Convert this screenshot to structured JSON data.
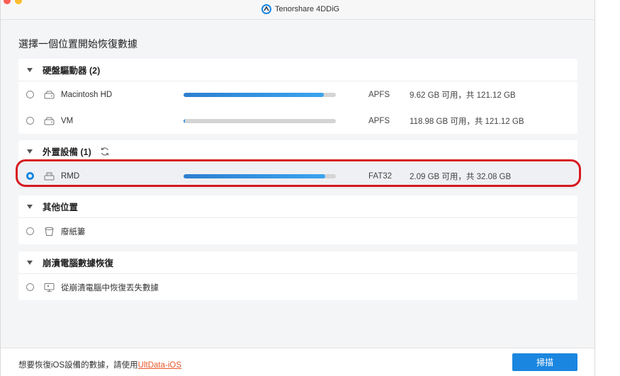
{
  "window": {
    "app_title": "Tenorshare 4DDiG"
  },
  "page": {
    "heading": "選擇一個位置開始恢復數據"
  },
  "sections": {
    "hard_drives": {
      "title": "硬盤驅動器 (2)",
      "items": [
        {
          "label": "Macintosh HD",
          "usage": 0.92,
          "fs": "APFS",
          "capacity": "9.62 GB 可用，共 121.12 GB"
        },
        {
          "label": "VM",
          "usage": 0.01,
          "fs": "APFS",
          "capacity": "118.98 GB 可用，共 121.12 GB"
        }
      ]
    },
    "external": {
      "title": "外置設備 (1)",
      "items": [
        {
          "label": "RMD",
          "usage": 0.93,
          "fs": "FAT32",
          "capacity": "2.09 GB 可用，共 32.08 GB",
          "selected": true
        }
      ]
    },
    "other": {
      "title": "其他位置",
      "items": [
        {
          "label": "廢紙簍"
        }
      ]
    },
    "crashed": {
      "title": "崩潰電腦數據恢復",
      "items": [
        {
          "label": "從崩潰電腦中恢復丟失數據"
        }
      ]
    }
  },
  "footer": {
    "prompt": "想要恢復iOS設備的數據，請使用",
    "link": "UltData-iOS",
    "scan_label": "掃描"
  },
  "colors": {
    "accent": "#1a86e0",
    "highlight": "#d61a1f",
    "link": "#e8562a"
  }
}
